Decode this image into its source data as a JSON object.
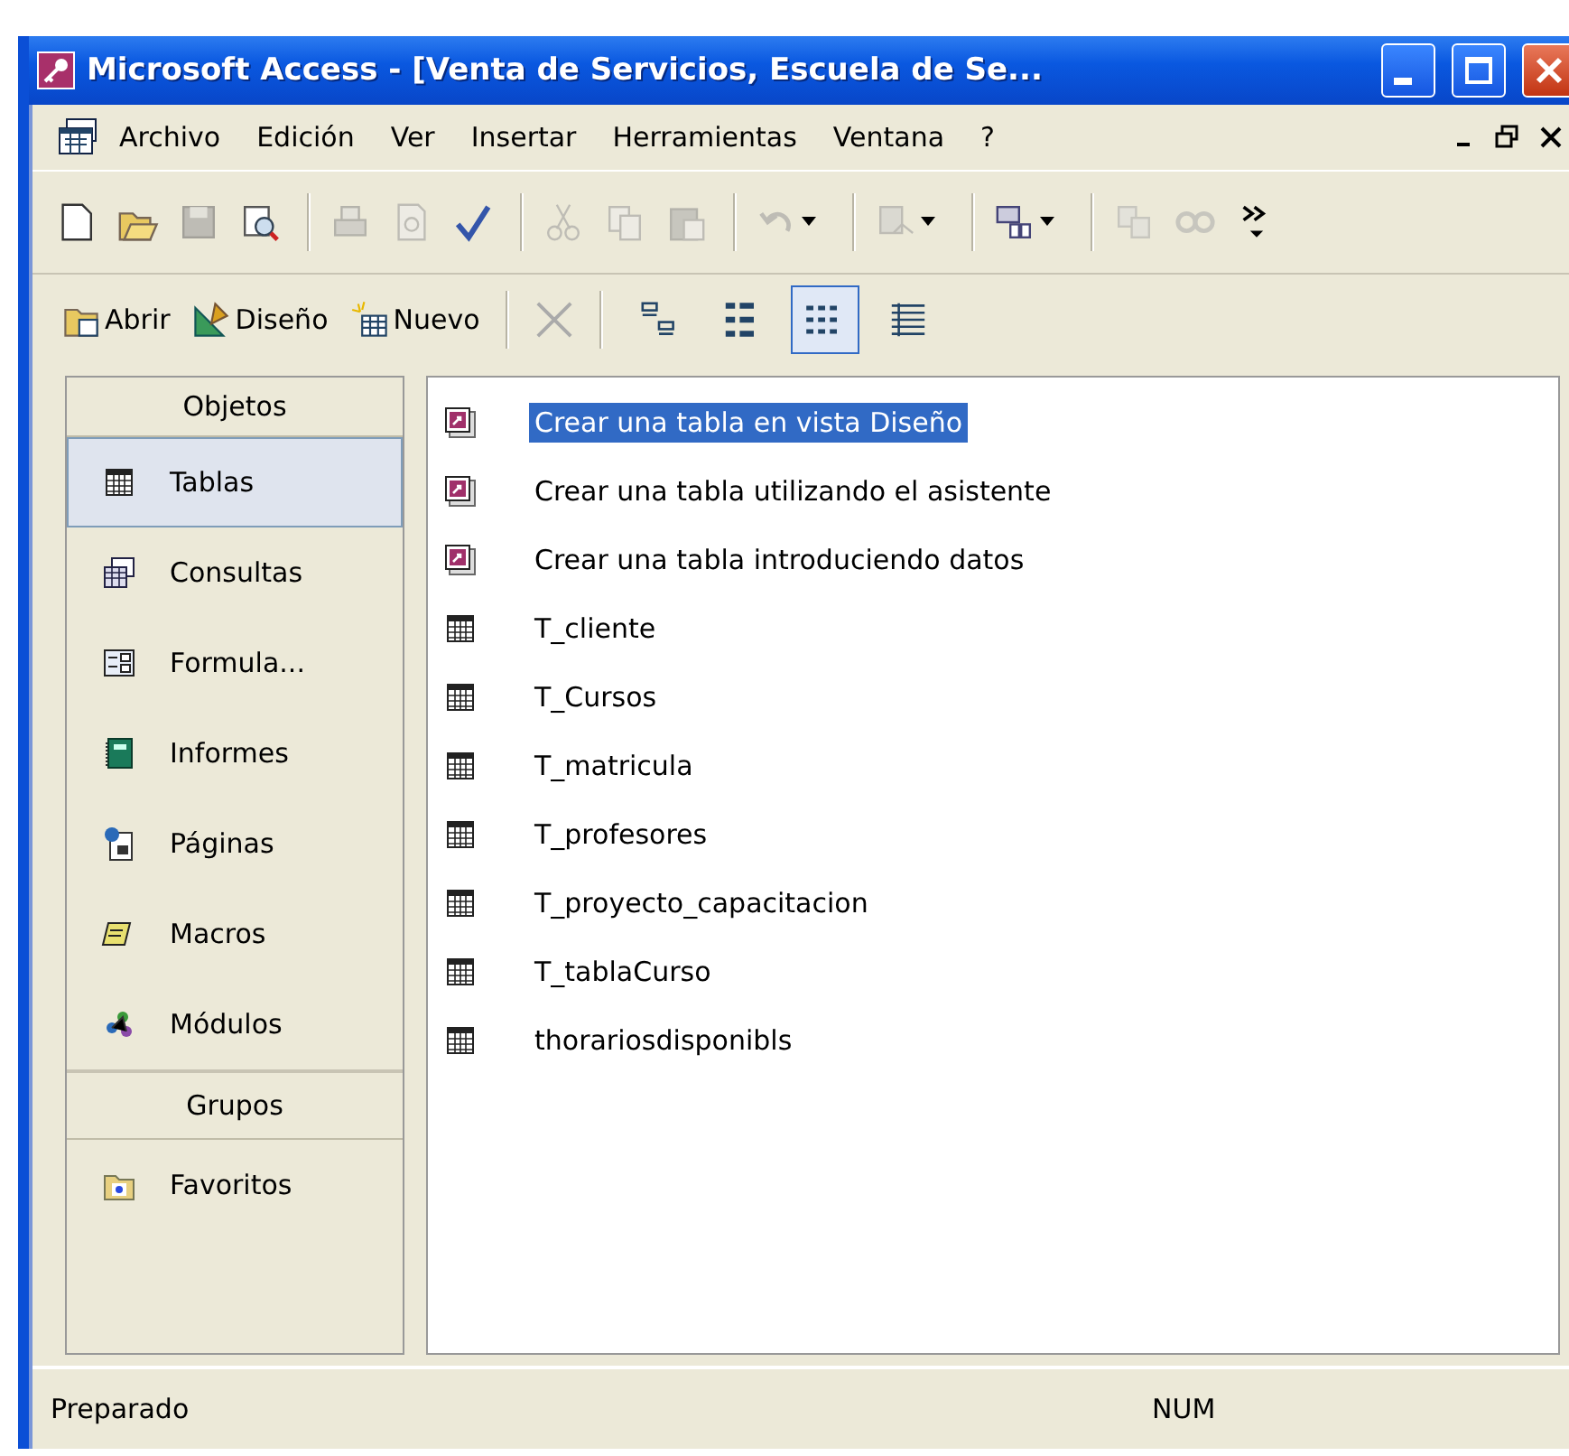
{
  "window": {
    "title": "Microsoft Access - [Venta de Servicios, Escuela de Se..."
  },
  "menu": [
    {
      "label": "Archivo"
    },
    {
      "label": "Edición"
    },
    {
      "label": "Ver"
    },
    {
      "label": "Insertar"
    },
    {
      "label": "Herramientas"
    },
    {
      "label": "Ventana"
    },
    {
      "label": "?"
    }
  ],
  "toolbar": [
    {
      "kind": "new",
      "disabled": false
    },
    {
      "kind": "open",
      "disabled": false
    },
    {
      "kind": "save",
      "disabled": true
    },
    {
      "kind": "search",
      "disabled": false
    },
    {
      "kind": "sep"
    },
    {
      "kind": "print",
      "disabled": true
    },
    {
      "kind": "preview",
      "disabled": true
    },
    {
      "kind": "spell",
      "disabled": false
    },
    {
      "kind": "sep"
    },
    {
      "kind": "cut",
      "disabled": true
    },
    {
      "kind": "copy",
      "disabled": true
    },
    {
      "kind": "paste",
      "disabled": true
    },
    {
      "kind": "sep"
    },
    {
      "kind": "undo",
      "disabled": true,
      "dropdown": true
    },
    {
      "kind": "sep"
    },
    {
      "kind": "links",
      "disabled": true,
      "dropdown": true
    },
    {
      "kind": "sep"
    },
    {
      "kind": "analyze",
      "disabled": false,
      "dropdown": true
    },
    {
      "kind": "sep"
    },
    {
      "kind": "relations",
      "disabled": true
    },
    {
      "kind": "chain",
      "disabled": true
    },
    {
      "kind": "more",
      "disabled": false
    }
  ],
  "db_toolbar": {
    "buttons": [
      {
        "kind": "open",
        "label": "Abrir"
      },
      {
        "kind": "design",
        "label": "Diseño"
      },
      {
        "kind": "new",
        "label": "Nuevo"
      }
    ],
    "views": [
      {
        "kind": "large",
        "selected": false
      },
      {
        "kind": "small",
        "selected": false
      },
      {
        "kind": "list",
        "selected": true
      },
      {
        "kind": "details",
        "selected": false
      }
    ]
  },
  "sidebar": {
    "header": "Objetos",
    "items": [
      {
        "kind": "table",
        "label": "Tablas",
        "selected": true
      },
      {
        "kind": "query",
        "label": "Consultas",
        "selected": false
      },
      {
        "kind": "form",
        "label": "Formula...",
        "selected": false
      },
      {
        "kind": "report",
        "label": "Informes",
        "selected": false
      },
      {
        "kind": "page",
        "label": "Páginas",
        "selected": false
      },
      {
        "kind": "macro",
        "label": "Macros",
        "selected": false
      },
      {
        "kind": "module",
        "label": "Módulos",
        "selected": false
      }
    ],
    "groups_header": "Grupos",
    "groups": [
      {
        "kind": "favorites",
        "label": "Favoritos",
        "selected": false
      }
    ]
  },
  "list": [
    {
      "kind": "shortcut",
      "label": "Crear una tabla en vista Diseño",
      "selected": true
    },
    {
      "kind": "shortcut",
      "label": "Crear una tabla utilizando el asistente",
      "selected": false
    },
    {
      "kind": "shortcut",
      "label": "Crear una tabla introduciendo datos",
      "selected": false
    },
    {
      "kind": "table",
      "label": "T_cliente",
      "selected": false
    },
    {
      "kind": "table",
      "label": "T_Cursos",
      "selected": false
    },
    {
      "kind": "table",
      "label": "T_matricula",
      "selected": false
    },
    {
      "kind": "table",
      "label": "T_profesores",
      "selected": false
    },
    {
      "kind": "table",
      "label": "T_proyecto_capacitacion",
      "selected": false
    },
    {
      "kind": "table",
      "label": "T_tablaCurso",
      "selected": false
    },
    {
      "kind": "table",
      "label": "thorariosdisponibls",
      "selected": false
    }
  ],
  "status_bar": {
    "message": "Preparado",
    "indicator": "NUM"
  }
}
